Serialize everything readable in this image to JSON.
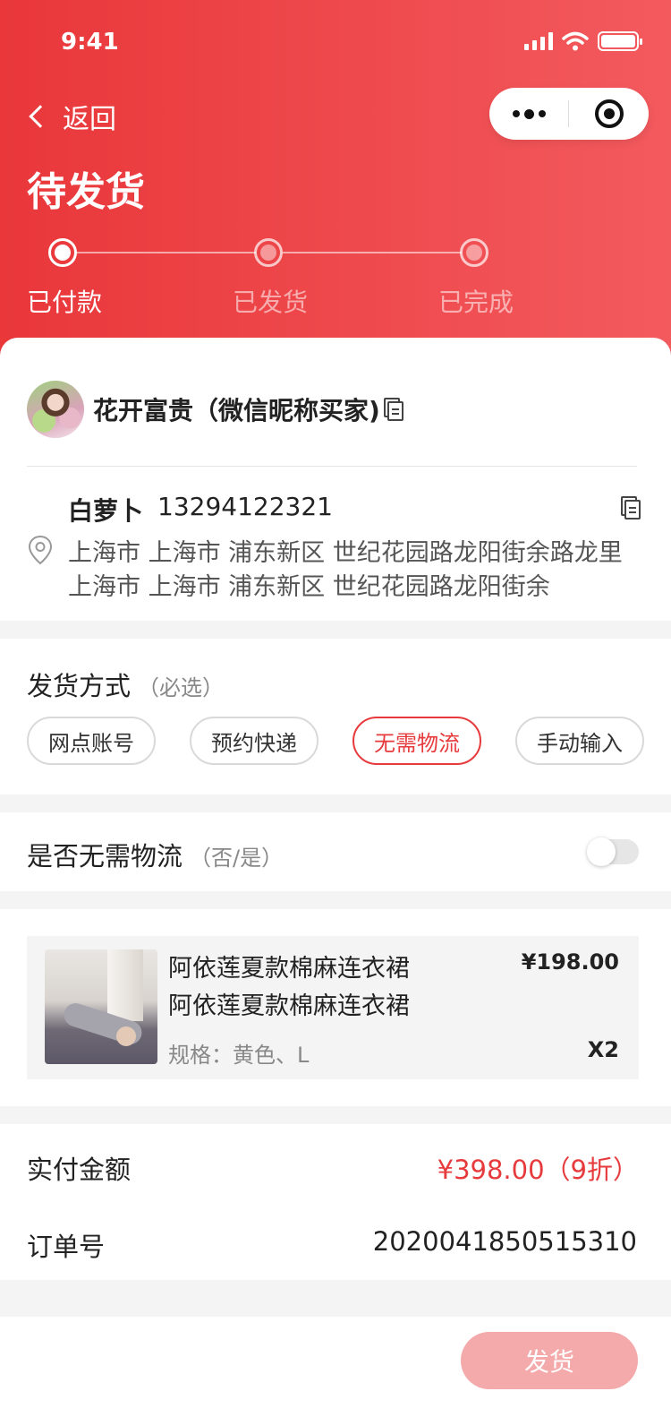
{
  "status_bar": {
    "time": "9:41"
  },
  "nav": {
    "back_label": "返回"
  },
  "page": {
    "title": "待发货"
  },
  "steps": [
    {
      "label": "已付款",
      "active": true
    },
    {
      "label": "已发货",
      "active": false
    },
    {
      "label": "已完成",
      "active": false
    }
  ],
  "buyer": {
    "name": "花开富贵（微信昵称买家)"
  },
  "address": {
    "name": "白萝卜",
    "phone": "13294122321",
    "line1": "上海市 上海市 浦东新区 世纪花园路龙阳街余路龙里",
    "line2": "上海市 上海市 浦东新区 世纪花园路龙阳街余"
  },
  "shipping": {
    "title": "发货方式",
    "hint": "（必选）",
    "options": [
      "网点账号",
      "预约快递",
      "无需物流",
      "手动输入"
    ],
    "selected": "无需物流"
  },
  "no_logistics": {
    "label": "是否无需物流",
    "hint": "（否/是）",
    "enabled": false
  },
  "product": {
    "title_line1": "阿依莲夏款棉麻连衣裙",
    "title_line2": "阿依莲夏款棉麻连衣裙",
    "spec": "规格：黄色、L",
    "price": "¥198.00",
    "qty": "X2"
  },
  "order": {
    "paid_label": "实付金额",
    "paid_amount": "¥398.00（9折）",
    "order_no_label": "订单号",
    "order_no": "2020041850515310"
  },
  "footer": {
    "ship_button": "发货"
  },
  "colors": {
    "accent": "#e73a3d",
    "header_start": "#e9373a",
    "header_end": "#f35a5e",
    "button_disabled": "#f4a9aa"
  }
}
